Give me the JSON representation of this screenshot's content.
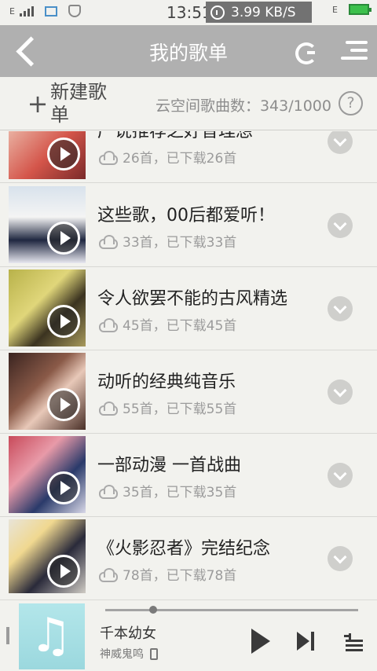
{
  "status_bar": {
    "network_left": "E",
    "time": "13:51",
    "speed": "3.99 KB/S",
    "network_right": "E"
  },
  "header": {
    "title": "我的歌单",
    "back_icon": "back-arrow-icon",
    "refresh_icon": "refresh-icon",
    "menu_icon": "menu-icon",
    "accent": "#b0b0b0"
  },
  "subbar": {
    "new_label": "新建歌单",
    "plus": "+",
    "cloud_count": "云空间歌曲数：343/1000",
    "help": "?"
  },
  "playlists": [
    {
      "title": "产说推荐之好音理想",
      "meta": "26首，已下载26首"
    },
    {
      "title": "这些歌，00后都爱听！",
      "meta": "33首，已下载33首"
    },
    {
      "title": "令人欲罢不能的古风精选",
      "meta": "45首，已下载45首"
    },
    {
      "title": "动听的经典纯音乐",
      "meta": "55首，已下载55首"
    },
    {
      "title": "一部动漫 一首战曲",
      "meta": "35首，已下载35首"
    },
    {
      "title": "《火影忍者》完结纪念",
      "meta": "78首，已下载78首"
    }
  ],
  "player": {
    "song": "千本幼女",
    "artist": "神威鬼鸣",
    "note": "♫",
    "progress": 0.19
  }
}
